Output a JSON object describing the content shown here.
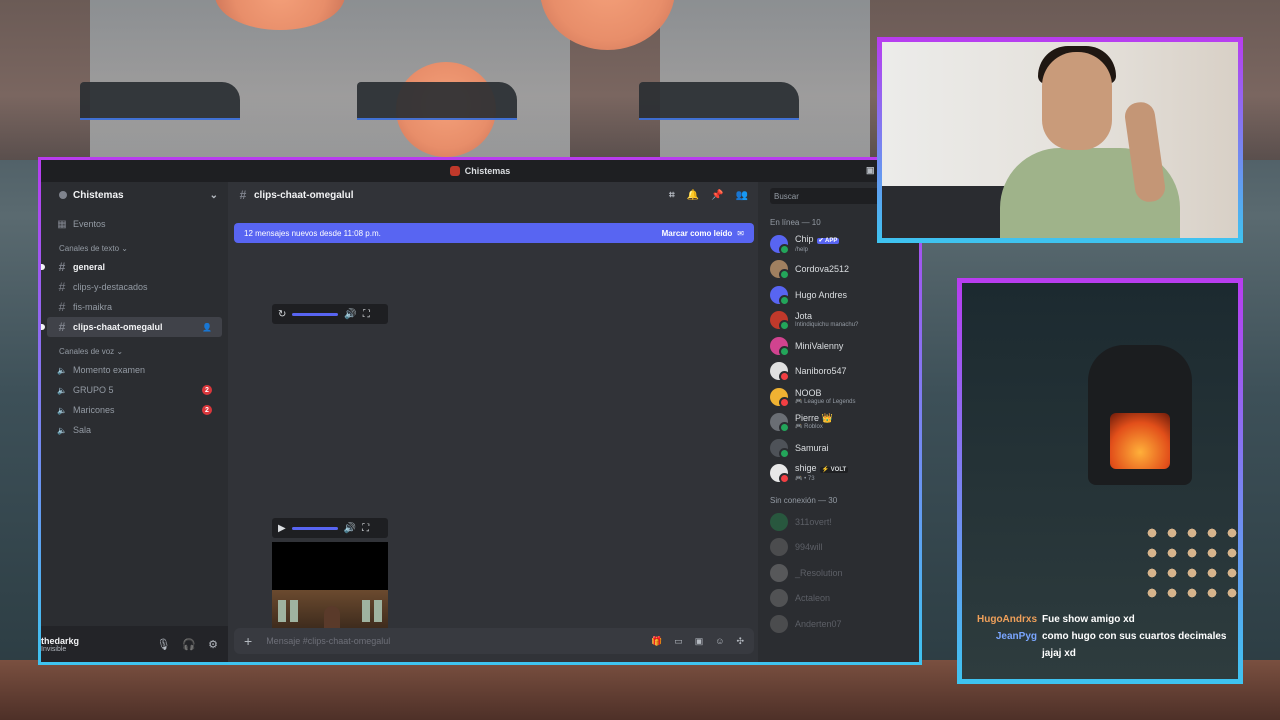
{
  "colors": {
    "accent": "#5865f2",
    "frame_top": "#b93cf0",
    "frame_bottom": "#3ec4f0",
    "online": "#23a55a",
    "dnd": "#f23f43",
    "idle": "#f0b232",
    "offline": "#80848e",
    "chat_user1": "#f0a05a",
    "chat_user2": "#7aa6ff"
  },
  "titlebar": {
    "server": "Chistemas",
    "icons": [
      "inbox-icon",
      "help-icon",
      "minimize-icon"
    ]
  },
  "sidebar": {
    "server_name": "Chistemas",
    "events_label": "Eventos",
    "text_category": "Canales de texto ⌄",
    "text_channels": [
      {
        "label": "general",
        "unread": true
      },
      {
        "label": "clips-y-destacados",
        "unread": false
      },
      {
        "label": "fis-maikra",
        "unread": false
      },
      {
        "label": "clips-chaat-omegalul",
        "unread": true,
        "active": true
      }
    ],
    "voice_category": "Canales de voz ⌄",
    "voice_channels": [
      {
        "label": "Momento examen",
        "badge": ""
      },
      {
        "label": "GRUPO 5",
        "badge": "2"
      },
      {
        "label": "Maricones",
        "badge": "2"
      },
      {
        "label": "Sala",
        "badge": ""
      }
    ]
  },
  "user": {
    "name": "thedarkg",
    "status": "Invisible",
    "icons": [
      "microphone-icon",
      "headphones-icon",
      "settings-icon"
    ]
  },
  "channel": {
    "name": "clips-chaat-omegalul",
    "header_icons": [
      "threads-icon",
      "bell-icon",
      "pin-icon",
      "members-icon"
    ]
  },
  "new_messages": {
    "text": "12 mensajes nuevos desde 11:08 p.m.",
    "action": "Marcar como leído"
  },
  "composer": {
    "placeholder": "Mensaje #clips-chaat-omegalul",
    "icons": [
      "gift-icon",
      "gif-icon",
      "sticker-icon",
      "emoji-icon",
      "apps-icon"
    ]
  },
  "members": {
    "search_placeholder": "Buscar",
    "online_header": "En línea — 10",
    "online": [
      {
        "name": "Chip",
        "sub": "/help",
        "tag": "✔ APP",
        "color": "#5865f2",
        "status": "online"
      },
      {
        "name": "Cordova2512",
        "sub": "",
        "tag": "",
        "color": "#a08060",
        "status": "online"
      },
      {
        "name": "Hugo Andres",
        "sub": "",
        "tag": "",
        "color": "#5865f2",
        "status": "online"
      },
      {
        "name": "Jota",
        "sub": "Intindiquichu manachu?",
        "tag": "",
        "color": "#c0392b",
        "status": "online"
      },
      {
        "name": "MiniValenny",
        "sub": "",
        "tag": "",
        "color": "#d1438f",
        "status": "online"
      },
      {
        "name": "Naniboro547",
        "sub": "",
        "tag": "",
        "color": "#e0e0e0",
        "status": "dnd"
      },
      {
        "name": "NOOB",
        "sub": "🎮 League of Legends",
        "tag": "",
        "color": "#f0b232",
        "status": "dnd"
      },
      {
        "name": "Pierre 👑",
        "sub": "🎮 Roblox",
        "tag": "",
        "color": "#6a6e74",
        "status": "online"
      },
      {
        "name": "Samurai",
        "sub": "",
        "tag": "",
        "color": "#4e5258",
        "status": "online"
      },
      {
        "name": "shige",
        "sub": "🎮 • 73",
        "tag": "⚡ VOLT",
        "color": "#e8e8e8",
        "status": "dnd"
      }
    ],
    "offline_header": "Sin conexión — 30",
    "offline": [
      {
        "name": "311overt!",
        "color": "#23a55a"
      },
      {
        "name": "994will",
        "color": "#888"
      },
      {
        "name": "_Resolution",
        "color": "#aaa"
      },
      {
        "name": "Actaleon",
        "color": "#999"
      },
      {
        "name": "Anderten07",
        "color": "#888"
      }
    ]
  },
  "chat": [
    {
      "user": "HugoAndrxs",
      "text": "Fue show amigo xd",
      "color": "#f0a05a"
    },
    {
      "user": "JeanPyg",
      "text": "como hugo con sus cuartos decimales jajaj xd",
      "color": "#7aa6ff"
    }
  ]
}
